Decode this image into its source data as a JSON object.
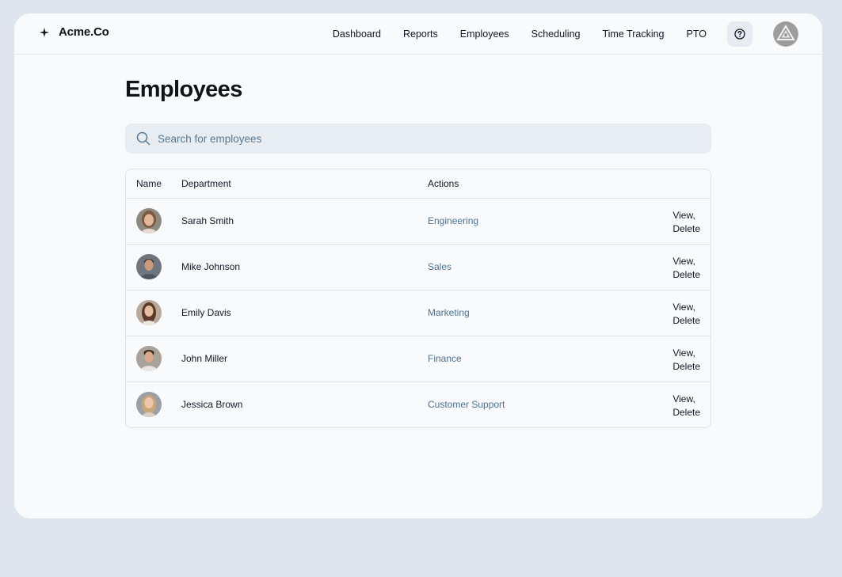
{
  "header": {
    "brand": "Acme.Co",
    "nav": [
      "Dashboard",
      "Reports",
      "Employees",
      "Scheduling",
      "Time Tracking",
      "PTO"
    ]
  },
  "page": {
    "title": "Employees",
    "search_placeholder": "Search for employees"
  },
  "table": {
    "columns": [
      "Name",
      "Department",
      "Actions"
    ],
    "rows": [
      {
        "name": "Sarah Smith",
        "department": "Engineering",
        "view": "View,",
        "delete": "Delete",
        "avatar_color": "#b58a6a"
      },
      {
        "name": "Mike Johnson",
        "department": "Sales",
        "view": "View,",
        "delete": "Delete",
        "avatar_color": "#7b7f86"
      },
      {
        "name": "Emily Davis",
        "department": "Marketing",
        "view": "View,",
        "delete": "Delete",
        "avatar_color": "#8a6a56"
      },
      {
        "name": "John Miller",
        "department": "Finance",
        "view": "View,",
        "delete": "Delete",
        "avatar_color": "#9a7a68"
      },
      {
        "name": "Jessica Brown",
        "department": "Customer Support",
        "view": "View,",
        "delete": "Delete",
        "avatar_color": "#c2a48a"
      }
    ]
  },
  "colors": {
    "link": "#4d7197",
    "background": "#dfe5ee",
    "panel": "#f8fafc"
  },
  "icons": [
    "sparkle-icon",
    "help-icon",
    "user-avatar",
    "search-icon"
  ]
}
